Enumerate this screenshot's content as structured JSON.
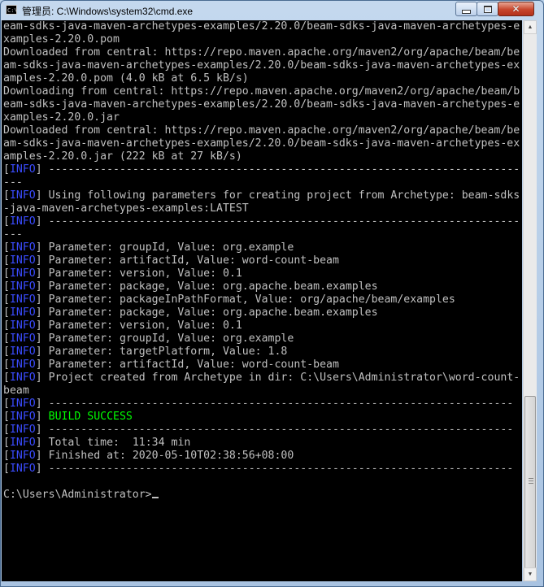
{
  "window": {
    "title": "管理员: C:\\Windows\\system32\\cmd.exe",
    "icon_label": "C:\\",
    "controls": {
      "minimize": "minimize",
      "maximize": "maximize",
      "close": "✕"
    }
  },
  "console": {
    "lines": [
      "eam-sdks-java-maven-archetypes-examples/2.20.0/beam-sdks-java-maven-archetypes-e",
      "xamples-2.20.0.pom",
      "Downloaded from central: https://repo.maven.apache.org/maven2/org/apache/beam/be",
      "am-sdks-java-maven-archetypes-examples/2.20.0/beam-sdks-java-maven-archetypes-ex",
      "amples-2.20.0.pom (4.0 kB at 6.5 kB/s)",
      "Downloading from central: https://repo.maven.apache.org/maven2/org/apache/beam/b",
      "eam-sdks-java-maven-archetypes-examples/2.20.0/beam-sdks-java-maven-archetypes-e",
      "xamples-2.20.0.jar",
      "Downloaded from central: https://repo.maven.apache.org/maven2/org/apache/beam/be",
      "am-sdks-java-maven-archetypes-examples/2.20.0/beam-sdks-java-maven-archetypes-ex",
      "amples-2.20.0.jar (222 kB at 27 kB/s)",
      "[INFO] -------------------------------------------------------------------------",
      "---",
      "[INFO] Using following parameters for creating project from Archetype: beam-sdks",
      "-java-maven-archetypes-examples:LATEST",
      "[INFO] -------------------------------------------------------------------------",
      "---",
      "[INFO] Parameter: groupId, Value: org.example",
      "[INFO] Parameter: artifactId, Value: word-count-beam",
      "[INFO] Parameter: version, Value: 0.1",
      "[INFO] Parameter: package, Value: org.apache.beam.examples",
      "[INFO] Parameter: packageInPathFormat, Value: org/apache/beam/examples",
      "[INFO] Parameter: package, Value: org.apache.beam.examples",
      "[INFO] Parameter: version, Value: 0.1",
      "[INFO] Parameter: groupId, Value: org.example",
      "[INFO] Parameter: targetPlatform, Value: 1.8",
      "[INFO] Parameter: artifactId, Value: word-count-beam",
      "[INFO] Project created from Archetype in dir: C:\\Users\\Administrator\\word-count-",
      "beam",
      "[INFO] ------------------------------------------------------------------------",
      "[INFO] BUILD SUCCESS",
      "[INFO] ------------------------------------------------------------------------",
      "[INFO] Total time:  11:34 min",
      "[INFO] Finished at: 2020-05-10T02:38:56+08:00",
      "[INFO] ------------------------------------------------------------------------",
      "",
      "C:\\Users\\Administrator>"
    ],
    "colors": {
      "background": "#000000",
      "text": "#c0c0c0",
      "info_tag": "#3a4cff",
      "success": "#00ff00"
    }
  },
  "scrollbar": {
    "up_arrow": "▲",
    "down_arrow": "▼"
  }
}
